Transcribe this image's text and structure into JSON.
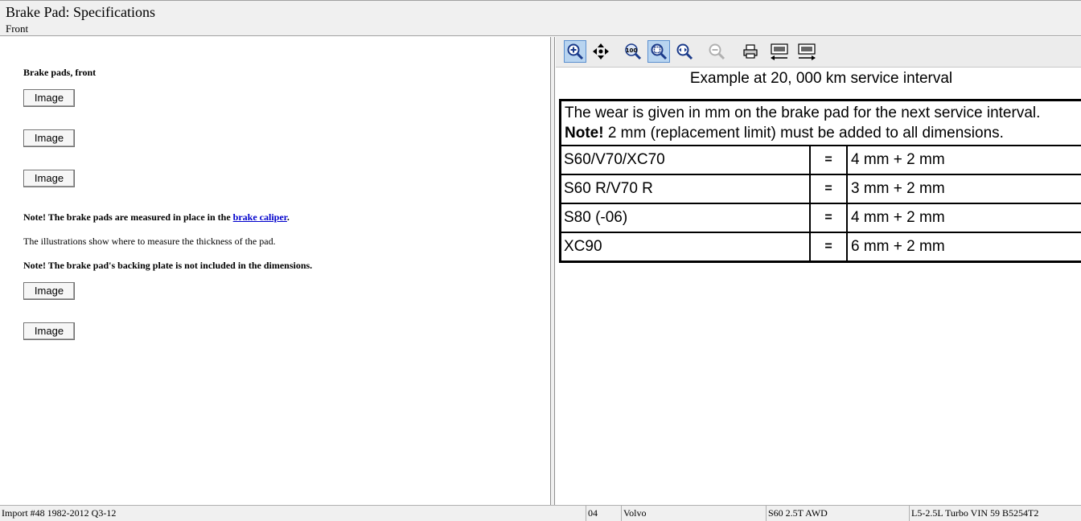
{
  "header": {
    "title": "Brake Pad:  Specifications",
    "subtitle": "Front"
  },
  "left": {
    "section_title": "Brake pads, front",
    "image_button_label": "Image",
    "note1_prefix": "Note! The brake pads are measured in place in the ",
    "note1_link": "brake caliper",
    "note1_suffix": ".",
    "note2": "The illustrations show where to measure the thickness of the pad.",
    "note3": "Note! The brake pad's backing plate is not included in the dimensions."
  },
  "toolbar": {
    "icons": [
      "zoom-in-icon",
      "pan-icon",
      "zoom-100-icon",
      "zoom-fit-icon",
      "zoom-width-icon",
      "zoom-out-icon",
      "print-icon",
      "previous-image-icon",
      "next-image-icon"
    ]
  },
  "document": {
    "heading": "Example at 20, 000 km service interval",
    "intro_line1": "The wear is given in mm on the brake pad for the next service interval.",
    "intro_note_bold": "Note!",
    "intro_note_rest": " 2 mm (replacement limit) must be added to all dimensions.",
    "rows": [
      {
        "model": "S60/V70/XC70",
        "eq": "=",
        "value": "4 mm + 2 mm"
      },
      {
        "model": "S60 R/V70 R",
        "eq": "=",
        "value": "3 mm + 2 mm"
      },
      {
        "model": "S80 (-06)",
        "eq": "=",
        "value": "4 mm + 2 mm"
      },
      {
        "model": "XC90",
        "eq": "=",
        "value": "6 mm + 2 mm"
      }
    ]
  },
  "status": {
    "import": "Import #48 1982-2012 Q3-12",
    "year": "04",
    "make": "Volvo",
    "model": "S60 2.5T AWD",
    "engine": "L5-2.5L Turbo VIN 59 B5254T2"
  }
}
